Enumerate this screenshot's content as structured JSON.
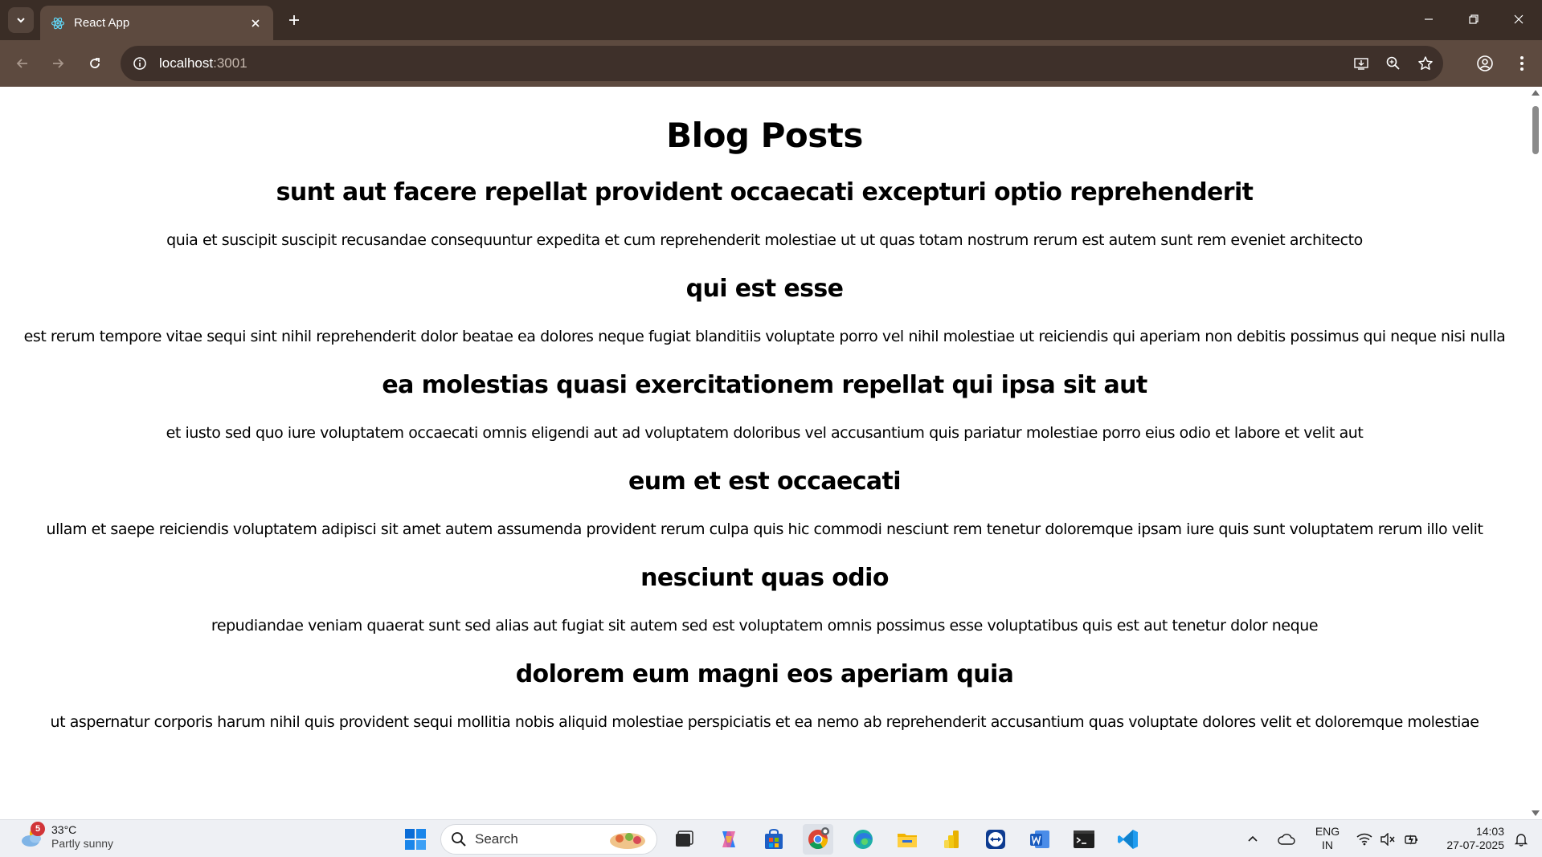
{
  "browser": {
    "tab": {
      "title": "React App"
    },
    "address_bar": {
      "host": "localhost",
      "port": ":3001"
    }
  },
  "page": {
    "heading": "Blog Posts",
    "posts": [
      {
        "title": "sunt aut facere repellat provident occaecati excepturi optio reprehenderit",
        "body": "quia et suscipit suscipit recusandae consequuntur expedita et cum reprehenderit molestiae ut ut quas totam nostrum rerum est autem sunt rem eveniet architecto"
      },
      {
        "title": "qui est esse",
        "body": "est rerum tempore vitae sequi sint nihil reprehenderit dolor beatae ea dolores neque fugiat blanditiis voluptate porro vel nihil molestiae ut reiciendis qui aperiam non debitis possimus qui neque nisi nulla"
      },
      {
        "title": "ea molestias quasi exercitationem repellat qui ipsa sit aut",
        "body": "et iusto sed quo iure voluptatem occaecati omnis eligendi aut ad voluptatem doloribus vel accusantium quis pariatur molestiae porro eius odio et labore et velit aut"
      },
      {
        "title": "eum et est occaecati",
        "body": "ullam et saepe reiciendis voluptatem adipisci sit amet autem assumenda provident rerum culpa quis hic commodi nesciunt rem tenetur doloremque ipsam iure quis sunt voluptatem rerum illo velit"
      },
      {
        "title": "nesciunt quas odio",
        "body": "repudiandae veniam quaerat sunt sed alias aut fugiat sit autem sed est voluptatem omnis possimus esse voluptatibus quis est aut tenetur dolor neque"
      },
      {
        "title": "dolorem eum magni eos aperiam quia",
        "body": "ut aspernatur corporis harum nihil quis provident sequi mollitia nobis aliquid molestiae perspiciatis et ea nemo ab reprehenderit accusantium quas voluptate dolores velit et doloremque molestiae"
      }
    ]
  },
  "taskbar": {
    "weather": {
      "temperature": "33°C",
      "condition": "Partly sunny",
      "badge": "5"
    },
    "search_label": "Search",
    "language": {
      "line1": "ENG",
      "line2": "IN"
    },
    "clock": {
      "time": "14:03",
      "date": "27-07-2025"
    }
  },
  "colors": {
    "chrome_dark": "#3a2d26",
    "chrome_toolbar": "#5d4a3f",
    "omnibox": "#3e302a",
    "taskbar": "#eef0f4"
  }
}
